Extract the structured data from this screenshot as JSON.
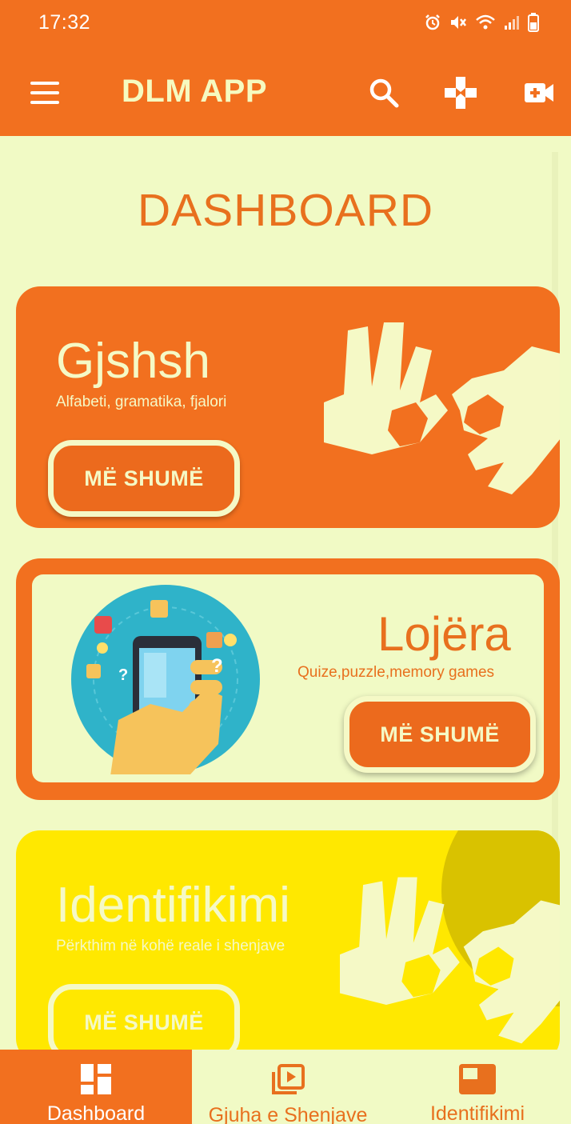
{
  "status_bar": {
    "time": "17:32",
    "icons": [
      "alarm-icon",
      "mute-icon",
      "wifi-icon",
      "signal-icon",
      "battery-icon"
    ]
  },
  "app_bar": {
    "title": "DLM APP",
    "icons": [
      "menu-icon",
      "search-icon",
      "gamepad-icon",
      "video-add-icon"
    ]
  },
  "main": {
    "title": "DASHBOARD",
    "cards": [
      {
        "title": "Gjshsh",
        "subtitle": "Alfabeti, gramatika, fjalori",
        "button": "MË SHUMË",
        "color": "#F2701F"
      },
      {
        "title": "Lojëra",
        "subtitle": "Quize,puzzle,memory games",
        "button": "MË SHUMË",
        "color": "#F2701F"
      },
      {
        "title": "Identifikimi",
        "subtitle": "Përkthim në kohë reale i shenjave",
        "button": "MË SHUMË",
        "color": "#FFE800"
      }
    ]
  },
  "bottom_nav": {
    "items": [
      {
        "label": "Dashboard",
        "icon": "dashboard-icon",
        "active": true
      },
      {
        "label": "Gjuha e Shenjave",
        "icon": "video-library-icon",
        "active": false
      },
      {
        "label": "Identifikimi",
        "icon": "identify-icon",
        "active": false
      }
    ]
  },
  "colors": {
    "primary": "#F2701F",
    "background": "#F1FAC5",
    "accent_yellow": "#FFE800"
  }
}
